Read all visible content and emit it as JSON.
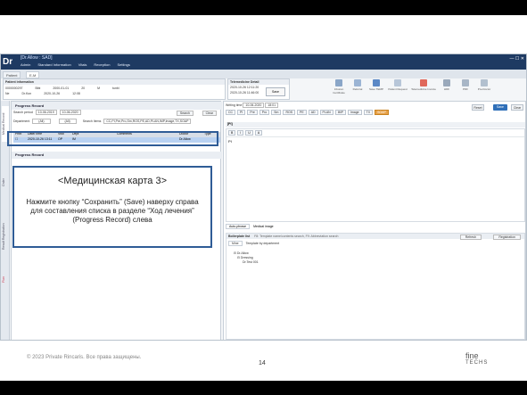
{
  "app": {
    "logo": "Dr",
    "user_line": "[Dr.Allow : SAD]",
    "menu": [
      "Admin",
      "Standard Information",
      "Vitals",
      "Reception",
      "Settings"
    ]
  },
  "tabs": [
    "Patient",
    "E-M"
  ],
  "patient": {
    "header": "Patient information",
    "id": "0000000297",
    "name": "Bibi",
    "dob": "2000-01-01",
    "age": "20",
    "sex": "M",
    "ins": "tunbi",
    "ward": "Ne",
    "doc": "Dr.Kon",
    "date2": "2020-10-26",
    "time2": "12:08"
  },
  "right_info": {
    "header": "Telemedicine Detail",
    "line1": "2020-10-26 12:11:20",
    "line2": "2020-10-26 11:46:00",
    "save": "Save"
  },
  "tool_icons": [
    {
      "label": "Infusion Certificate",
      "color": "#8aa6c8"
    },
    {
      "label": "Referral",
      "color": "#9bb4d4"
    },
    {
      "label": "Save TEMP",
      "color": "#5b88c6"
    },
    {
      "label": "Patient Request",
      "color": "#b7c6d8"
    },
    {
      "label": "Telemedicine Invoice",
      "color": "#e0685a"
    },
    {
      "label": "HDF",
      "color": "#9aa9bb"
    },
    {
      "label": "PDF",
      "color": "#a8b6c6"
    },
    {
      "label": "Pre-Doctor",
      "color": "#b2c0cf"
    }
  ],
  "left": {
    "section": "Progress Record",
    "search_label": "Search period",
    "date_from": "10-06-2019",
    "date_to": "10-06-2020",
    "dept_label": "Department",
    "dept_value": "(All)",
    "doctor_value": "(All)",
    "search_items_label": "Search Items",
    "search_items_value": "CC,PI,Pre,Pro,Sm,ROS,PE,AD,PLAN,IMP,Image,TX,SOAP",
    "search_btn": "Search",
    "clear_btn": "Clear",
    "columns": [
      "Print",
      "Date/Time",
      "Visit",
      "Dept",
      "Comments",
      "Doctor",
      "Type"
    ],
    "row": [
      "",
      "2020-10-26 13:11",
      "OP",
      "IM",
      "",
      "Dr.Allow",
      ""
    ],
    "section2": "Progress Record"
  },
  "editor": {
    "writing_time_label": "Writing time",
    "writing_time_date": "10-06-2020",
    "writing_time_hour": "18:01",
    "tabs": [
      "CC",
      "PI",
      "Pre",
      "Pro",
      "Sm",
      "ROS",
      "PE",
      "AD",
      "PLAN",
      "IMP",
      "Image",
      "TX",
      "SOAP"
    ],
    "active_tab": "SOAP",
    "save_btn": "Save",
    "clear_btn": "Clear",
    "reset_btn": "Reset",
    "section_pr": "[PI]",
    "pr_text": "PI",
    "lower_tab1": "Auto-phrase",
    "lower_tab2": "Medical image",
    "bp_label": "Boilerplate list",
    "bp_hint": "F8: Template name/contents search, F9: Abbreviation search",
    "sub_tab1": "Mine",
    "sub_tab2": "Template by department",
    "tree": [
      "Dr.Allow",
      "Dressing",
      "Dr.Test 001"
    ],
    "refresh_btn": "Refresh",
    "registration_btn": "Registration"
  },
  "sidebar_tabs": [
    "Medical Record",
    "Order",
    "Result Registration",
    "Plan"
  ],
  "callout": {
    "title": "<Медицинская карта 3>",
    "body": "Нажмите кнопку “Сохранить” (Save) наверху справа для составления списка в разделе “Ход лечения” (Progress Record) слева"
  },
  "footer": {
    "copyright": "© 2023 Private Rincaris. Все права защищены.",
    "page": "14",
    "brand_line1": "fine",
    "brand_line2": "TECHS"
  },
  "colors": {
    "titlebar": "#1e3a62",
    "accent": "#2f5c96",
    "highlight_row": "#b9d2f2",
    "active_tab": "#e7a24a"
  }
}
